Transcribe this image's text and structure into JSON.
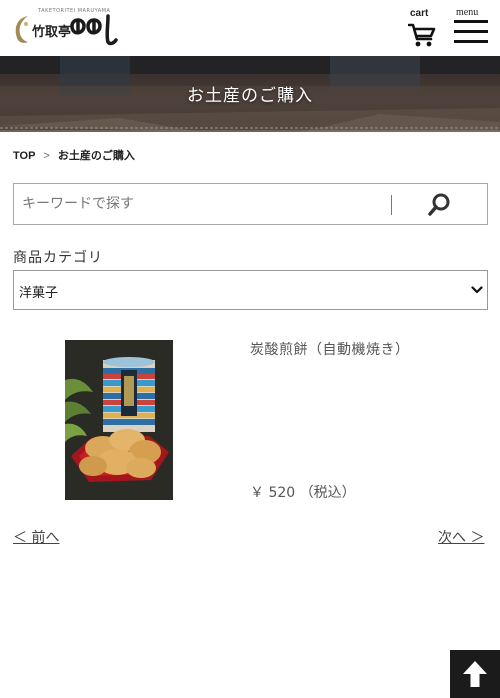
{
  "header": {
    "logo": {
      "small_text": "TAKETORITEI MARUYAMA",
      "kanji_text": "竹取亭",
      "brand_mark": "丸山"
    },
    "cart_label": "cart",
    "cart_icon": "cart-icon",
    "menu_label": "menu",
    "menu_icon": "hamburger-icon"
  },
  "banner": {
    "title": "お土産のご購入"
  },
  "breadcrumb": {
    "items": [
      "TOP",
      "お土産のご購入"
    ],
    "separator": ">"
  },
  "search": {
    "placeholder": "キーワードで探す",
    "value": "",
    "button_icon": "search-icon"
  },
  "category": {
    "label": "商品カテゴリ",
    "selected": "洋菓子"
  },
  "products": [
    {
      "name": "炭酸煎餅（自動機焼き）",
      "price": "￥ 520 （税込）",
      "image": "product-photo"
    }
  ],
  "pagination": {
    "prev": "＜ 前へ",
    "next": "次へ ＞"
  },
  "page_top_icon": "arrow-up-icon",
  "colors": {
    "banner_dark": "#4a3f3b",
    "page_top_bg": "#1b1b1b",
    "text": "#333333"
  }
}
